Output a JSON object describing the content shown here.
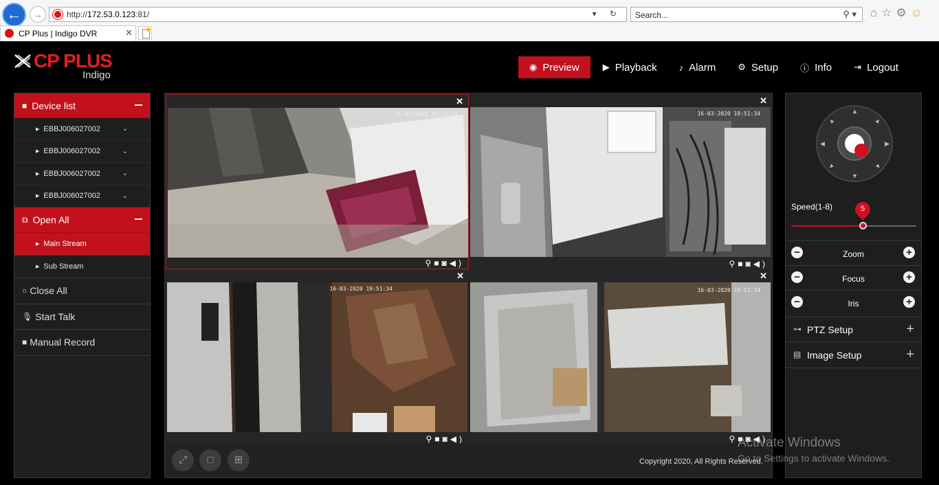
{
  "browser": {
    "url_prefix": "http://",
    "url_host": "172.53.0.123",
    "url_port": ":81/",
    "search_placeholder": "Search...",
    "tab_title": "CP Plus | Indigo DVR"
  },
  "logo": {
    "brand": "CP PLUS",
    "sub": "Indigo"
  },
  "nav": [
    {
      "label": "Preview",
      "icon": "eye-icon"
    },
    {
      "label": "Playback",
      "icon": "play-icon"
    },
    {
      "label": "Alarm",
      "icon": "bell-icon"
    },
    {
      "label": "Setup",
      "icon": "gear-icon"
    },
    {
      "label": "Info",
      "icon": "info-icon"
    },
    {
      "label": "Logout",
      "icon": "logout-icon"
    }
  ],
  "sidebar": {
    "device_list_label": "Device list",
    "devices": [
      "EBBJ006027002",
      "EBBJ006027002",
      "EBBJ006027002",
      "EBBJ006027002"
    ],
    "open_all_label": "Open All",
    "streams": [
      "Main Stream",
      "Sub Stream"
    ],
    "close_all_label": "Close All",
    "start_talk_label": "Start Talk",
    "manual_record_label": "Manual Record"
  },
  "cameras": [
    {
      "timestamp": "16-03-2020 19:51:34"
    },
    {
      "timestamp": "16-03-2020 19:51:34"
    },
    {
      "timestamp": "16-03-2020 19:51:34"
    },
    {
      "timestamp": "16-03-2020 19:51:34"
    }
  ],
  "footer": {
    "copyright": "Copyright 2020, All Rights Reserved."
  },
  "ptz": {
    "speed_label": "Speed(1-8)",
    "speed_value": "5",
    "speed_min": 1,
    "speed_max": 8,
    "zoom_label": "Zoom",
    "focus_label": "Focus",
    "iris_label": "Iris",
    "ptz_setup_label": "PTZ Setup",
    "image_setup_label": "Image Setup"
  },
  "watermark": {
    "line1": "Activate Windows",
    "line2": "Go to Settings to activate Windows."
  },
  "colors": {
    "accent": "#c2101c",
    "panel": "#1e1e1e",
    "background": "#000000"
  }
}
